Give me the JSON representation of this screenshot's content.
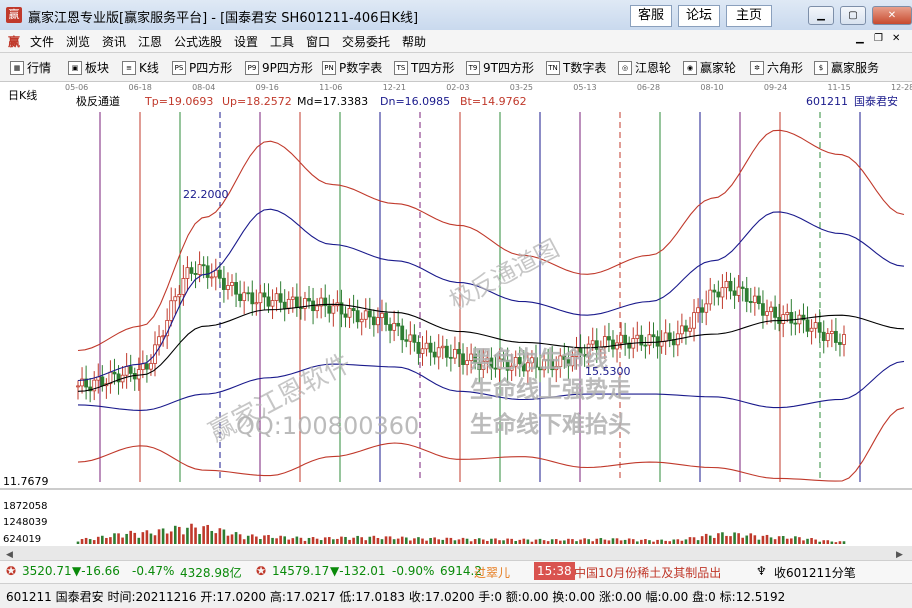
{
  "window": {
    "title": "赢家江恩专业版[赢家服务平台] - [国泰君安  SH601211-406日K线]",
    "app_icon": "赢",
    "buttons": [
      "客服",
      "论坛",
      "主页"
    ],
    "controls": [
      "minimize",
      "maximize",
      "close"
    ]
  },
  "menu": {
    "items": [
      "文件",
      "浏览",
      "资讯",
      "江恩",
      "公式选股",
      "设置",
      "工具",
      "窗口",
      "交易委托",
      "帮助"
    ]
  },
  "toolbar": {
    "items": [
      {
        "label": "行情",
        "icon": "grid-icon",
        "icon_text": "▦"
      },
      {
        "label": "板块",
        "icon": "blocks-icon",
        "icon_text": "▣"
      },
      {
        "label": "K线",
        "icon": "candles-icon",
        "icon_text": "≡"
      },
      {
        "label": "P四方形",
        "icon": "ps-icon",
        "icon_text": "PS"
      },
      {
        "label": "9P四方形",
        "icon": "p9-icon",
        "icon_text": "P9"
      },
      {
        "label": "P数字表",
        "icon": "pn-icon",
        "icon_text": "PN"
      },
      {
        "label": "T四方形",
        "icon": "ts-icon",
        "icon_text": "TS"
      },
      {
        "label": "9T四方形",
        "icon": "t9-icon",
        "icon_text": "T9"
      },
      {
        "label": "T数字表",
        "icon": "tn-icon",
        "icon_text": "TN"
      },
      {
        "label": "江恩轮",
        "icon": "gann-wheel-icon",
        "icon_text": "◎"
      },
      {
        "label": "赢家轮",
        "icon": "big-wheel-icon",
        "icon_text": "◉"
      },
      {
        "label": "六角形",
        "icon": "hexagon-icon",
        "icon_text": "✲"
      },
      {
        "label": "赢家服务",
        "icon": "dollar-icon",
        "icon_text": "$"
      }
    ]
  },
  "chart_header": {
    "period": "日K线",
    "indicator": "极反通道",
    "tp": "Tp=19.0693",
    "up": "Up=18.2572",
    "md": "Md=17.3383",
    "dn": "Dn=16.0985",
    "bt": "Bt=14.9762",
    "code": "601211",
    "name": "国泰君安"
  },
  "date_ticks": [
    "05-06",
    "06-18",
    "08-04",
    "09-16",
    "11-06",
    "12-21",
    "02-03",
    "03-25",
    "05-13",
    "06-28",
    "08-10",
    "09-24",
    "11-15",
    "12-28"
  ],
  "y_labels": {
    "bottom": "11.7679"
  },
  "price_annotations": {
    "high": "22.2000",
    "low": "15.5300"
  },
  "volume_labels": [
    "1872058",
    "1248039",
    "624019"
  ],
  "watermarks": [
    "赢家江恩软件",
    "极反通道图",
    "黑色为生命线",
    "生命线上强势走",
    "生命线下难抬头",
    "QQ:100800360"
  ],
  "status_bar_1": {
    "sh_value": "3520.71",
    "sh_change": "▼-16.66",
    "sh_pct": "-0.47%",
    "sh_amount": "4328.98亿",
    "sz_value": "14579.17",
    "sz_change": "▼-132.01",
    "sz_pct": "-0.90%",
    "sz_amount": "6914.2",
    "news_name": "过翠儿",
    "news_time": "15:38",
    "news_text": "中国10月份稀土及其制品出",
    "right_text": "收601211分笔"
  },
  "status_bar_2": {
    "text": "601211 国泰君安 时间:20211216 开:17.0200 高:17.0217 低:17.0183 收:17.0200 手:0 额:0.00 换:0.00 涨:0.00 幅:0.00 盘:0 标:12.5192"
  },
  "chart_data": {
    "type": "line",
    "title": "极反通道",
    "x": [
      "05-06",
      "06-18",
      "08-04",
      "09-16",
      "11-06",
      "12-21",
      "02-03",
      "03-25",
      "05-13",
      "06-28",
      "08-10",
      "09-24",
      "11-15",
      "12-28"
    ],
    "series": [
      {
        "name": "Tp",
        "values": [
          16.6,
          17.5,
          21.5,
          24.3,
          22.7,
          22.0,
          21.2,
          20.1,
          19.4,
          20.1,
          22.2,
          24.7,
          23.8,
          21.6
        ]
      },
      {
        "name": "Up",
        "values": [
          15.5,
          16.1,
          19.4,
          21.8,
          20.5,
          19.9,
          19.1,
          18.4,
          17.9,
          18.4,
          19.9,
          21.7,
          20.9,
          19.7
        ]
      },
      {
        "name": "Md",
        "values": [
          15.1,
          15.7,
          17.5,
          18.1,
          18.3,
          18.0,
          17.3,
          16.9,
          16.7,
          16.9,
          17.2,
          17.7,
          17.9,
          17.4
        ]
      },
      {
        "name": "Dn",
        "values": [
          14.6,
          14.4,
          15.0,
          15.6,
          16.1,
          16.0,
          15.1,
          14.8,
          15.0,
          15.0,
          14.9,
          14.5,
          14.8,
          16.2
        ]
      },
      {
        "name": "Bt",
        "values": [
          12.5,
          13.1,
          12.2,
          12.0,
          12.7,
          13.2,
          12.6,
          12.7,
          12.3,
          12.5,
          12.3,
          11.9,
          11.8,
          14.5
        ]
      },
      {
        "name": "Close",
        "values": [
          15.3,
          15.8,
          19.6,
          18.5,
          18.3,
          17.8,
          16.6,
          16.1,
          16.1,
          16.9,
          17.0,
          18.9,
          17.8,
          17.0
        ]
      }
    ],
    "volume": [
      180000,
      420000,
      640000,
      300000,
      220000,
      260000,
      210000,
      180000,
      160000,
      190000,
      140000,
      380000,
      260000,
      90000
    ],
    "ylim": [
      11.7679,
      25.0
    ],
    "volume_ylim": [
      0,
      2200000
    ]
  }
}
